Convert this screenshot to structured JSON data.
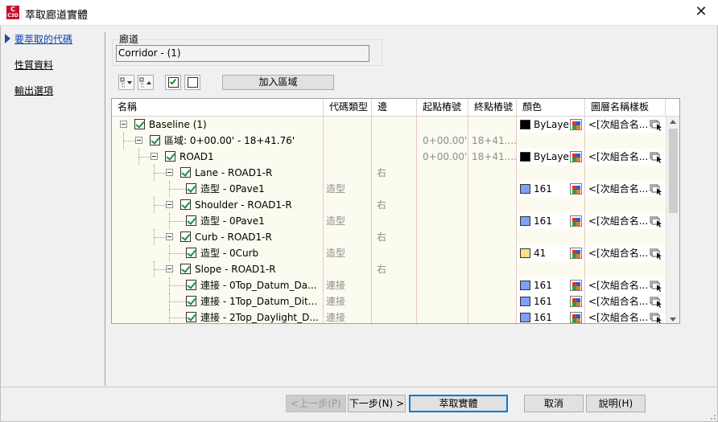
{
  "window": {
    "title": "萃取廊道實體",
    "app_icon_text": "C",
    "app_icon_sub": "C3D"
  },
  "nav": {
    "items": [
      {
        "label": "要萃取的代碼"
      },
      {
        "label": "性質資料"
      },
      {
        "label": "輸出選項"
      }
    ]
  },
  "corridor": {
    "label": "廊道",
    "value": "Corridor - (1)"
  },
  "toolbar": {
    "add_region_label": "加入區域"
  },
  "grid": {
    "headers": [
      "名稱",
      "代碼類型",
      "邊",
      "起點樁號",
      "終點樁號",
      "顏色",
      "圖層名稱樣板"
    ],
    "rows": [
      {
        "name": "Baseline (1)",
        "type": "",
        "side": "",
        "start": "",
        "end": "",
        "color": "ByLayer",
        "swatch": "#000000",
        "layer": "<[次組合名..."
      },
      {
        "name": "區域: 0+00.00' - 18+41.76'",
        "type": "",
        "side": "",
        "start": "0+00.00'",
        "end": "18+41....",
        "color": "",
        "swatch": "",
        "layer": ""
      },
      {
        "name": "ROAD1",
        "type": "",
        "side": "",
        "start": "0+00.00'",
        "end": "18+41....",
        "color": "ByLayer",
        "swatch": "#000000",
        "layer": "<[次組合名..."
      },
      {
        "name": "Lane - ROAD1-R",
        "type": "",
        "side": "右",
        "start": "",
        "end": "",
        "color": "",
        "swatch": "",
        "layer": ""
      },
      {
        "name": "造型 - 0Pave1",
        "type": "造型",
        "side": "",
        "start": "",
        "end": "",
        "color": "161",
        "swatch": "#7f9fff",
        "layer": "<[次組合名..."
      },
      {
        "name": "Shoulder - ROAD1-R",
        "type": "",
        "side": "右",
        "start": "",
        "end": "",
        "color": "",
        "swatch": "",
        "layer": ""
      },
      {
        "name": "造型 - 0Pave1",
        "type": "造型",
        "side": "",
        "start": "",
        "end": "",
        "color": "161",
        "swatch": "#7f9fff",
        "layer": "<[次組合名..."
      },
      {
        "name": "Curb - ROAD1-R",
        "type": "",
        "side": "右",
        "start": "",
        "end": "",
        "color": "",
        "swatch": "",
        "layer": ""
      },
      {
        "name": "造型 - 0Curb",
        "type": "造型",
        "side": "",
        "start": "",
        "end": "",
        "color": "41",
        "swatch": "#ffdf7f",
        "layer": "<[次組合名..."
      },
      {
        "name": "Slope - ROAD1-R",
        "type": "",
        "side": "右",
        "start": "",
        "end": "",
        "color": "",
        "swatch": "",
        "layer": ""
      },
      {
        "name": "連接 - 0Top_Datum_Da...",
        "type": "連接",
        "side": "",
        "start": "",
        "end": "",
        "color": "161",
        "swatch": "#7f9fff",
        "layer": "<[次組合名..."
      },
      {
        "name": "連接 - 1Top_Datum_Dit...",
        "type": "連接",
        "side": "",
        "start": "",
        "end": "",
        "color": "161",
        "swatch": "#7f9fff",
        "layer": "<[次組合名..."
      },
      {
        "name": "連接 - 2Top_Daylight_D...",
        "type": "連接",
        "side": "",
        "start": "",
        "end": "",
        "color": "161",
        "swatch": "#7f9fff",
        "layer": "<[次組合名..."
      }
    ]
  },
  "buttons": {
    "back": "<上一步(P)",
    "next": "下一步(N) >",
    "extract": "萃取實體",
    "cancel": "取消",
    "help": "說明(H)"
  },
  "colors": {
    "accent": "#0078d7",
    "grid_bg": "#fbfbef",
    "nav_arrow": "#1a4fa0",
    "check": "#1e8e3e"
  }
}
